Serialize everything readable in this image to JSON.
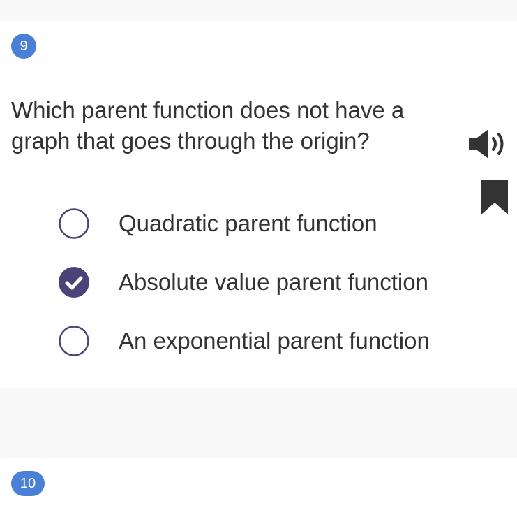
{
  "question": {
    "number": "9",
    "text": "Which parent function does not have a graph that goes through the origin?",
    "options": [
      {
        "label": "Quadratic parent function",
        "selected": false
      },
      {
        "label": "Absolute value parent function",
        "selected": true
      },
      {
        "label": "An exponential parent function",
        "selected": false
      }
    ]
  },
  "next_question": {
    "number": "10"
  },
  "colors": {
    "accent": "#4a7fd6",
    "radio_selected": "#4b4378",
    "text": "#333333"
  },
  "icons": {
    "audio": "speaker-icon",
    "bookmark": "bookmark-icon",
    "check": "check-icon"
  }
}
